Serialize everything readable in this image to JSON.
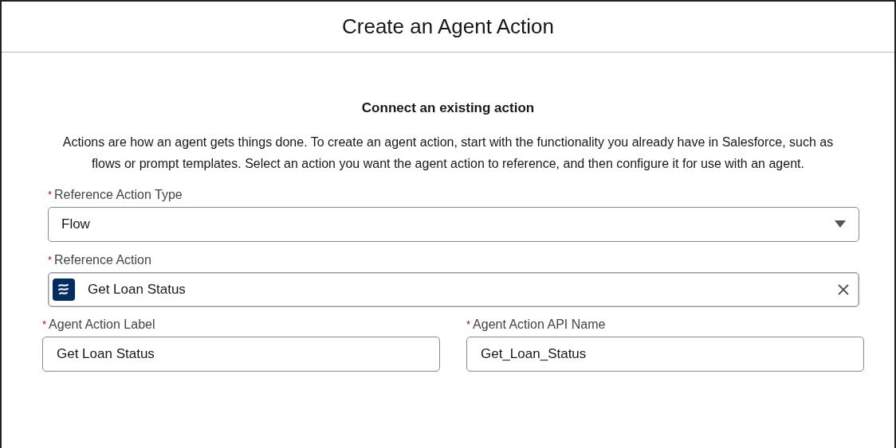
{
  "window": {
    "title": "Create an Agent Action"
  },
  "section": {
    "heading": "Connect an existing action",
    "description": "Actions are how an agent gets things done. To create an agent action, start with the functionality you already have in Salesforce, such as flows or prompt templates. Select an action you want the agent action to reference, and then configure it for use with an agent."
  },
  "fields": [
    {
      "kind": "dropdown",
      "required_mark": "*",
      "label": "Reference Action Type",
      "value": "Flow"
    },
    {
      "kind": "lookup",
      "required_mark": "*",
      "label": "Reference Action",
      "value": "Get Loan Status"
    }
  ],
  "pair_fields": [
    {
      "kind": "text",
      "required_mark": "*",
      "label": "Agent Action Label",
      "value": "Get Loan Status"
    },
    {
      "kind": "text",
      "required_mark": "*",
      "label": "Agent Action API Name",
      "value": "Get_Loan_Status"
    }
  ]
}
